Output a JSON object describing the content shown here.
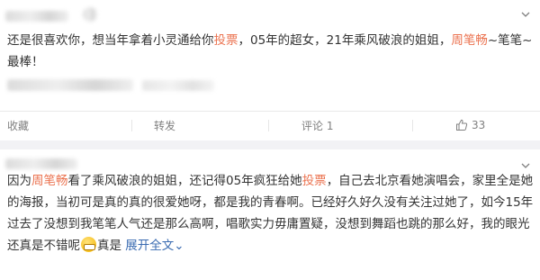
{
  "post1": {
    "segments": [
      {
        "text": "还是很喜欢你，想当年拿着小灵通给你",
        "style": "normal"
      },
      {
        "text": "投票",
        "style": "hl"
      },
      {
        "text": "，05年的超女，21年乘风破浪的姐姐，",
        "style": "normal"
      },
      {
        "text": "周笔畅",
        "style": "hl"
      },
      {
        "text": "~笔笔~最棒！",
        "style": "normal"
      }
    ],
    "actions": {
      "favorite": "收藏",
      "repost": "转发",
      "comment": "评论 1",
      "like_count": "33"
    }
  },
  "post2": {
    "segments": [
      {
        "text": "因为",
        "style": "normal"
      },
      {
        "text": "周笔畅",
        "style": "hl"
      },
      {
        "text": "看了乘风破浪的姐姐，还记得05年疯狂给她",
        "style": "normal"
      },
      {
        "text": "投票",
        "style": "hl"
      },
      {
        "text": "，自己去北京看她演唱会，家里全是她的海报，当初可是真的真的很爱她呀，都是我的青春啊。已经好久好久没有关注过她了，如今15年过去了没想到我笔笔人气还是那么高啊，唱歌实力毋庸置疑，没想到舞蹈也跳的那么好，我的眼光还真是不错呢",
        "style": "normal"
      },
      {
        "text": "[emoji]",
        "style": "emoji"
      },
      {
        "text": "真是 ",
        "style": "normal"
      },
      {
        "text": "展开全文",
        "style": "link"
      },
      {
        "text": "⌄",
        "style": "link"
      }
    ]
  },
  "colors": {
    "highlight": "#eb7350",
    "link": "#3a6bb1",
    "muted": "#808080"
  },
  "icons": {
    "chevron": "chevron-down-icon",
    "like": "thumbs-up-icon",
    "emoji": "grin-emoji-icon"
  }
}
